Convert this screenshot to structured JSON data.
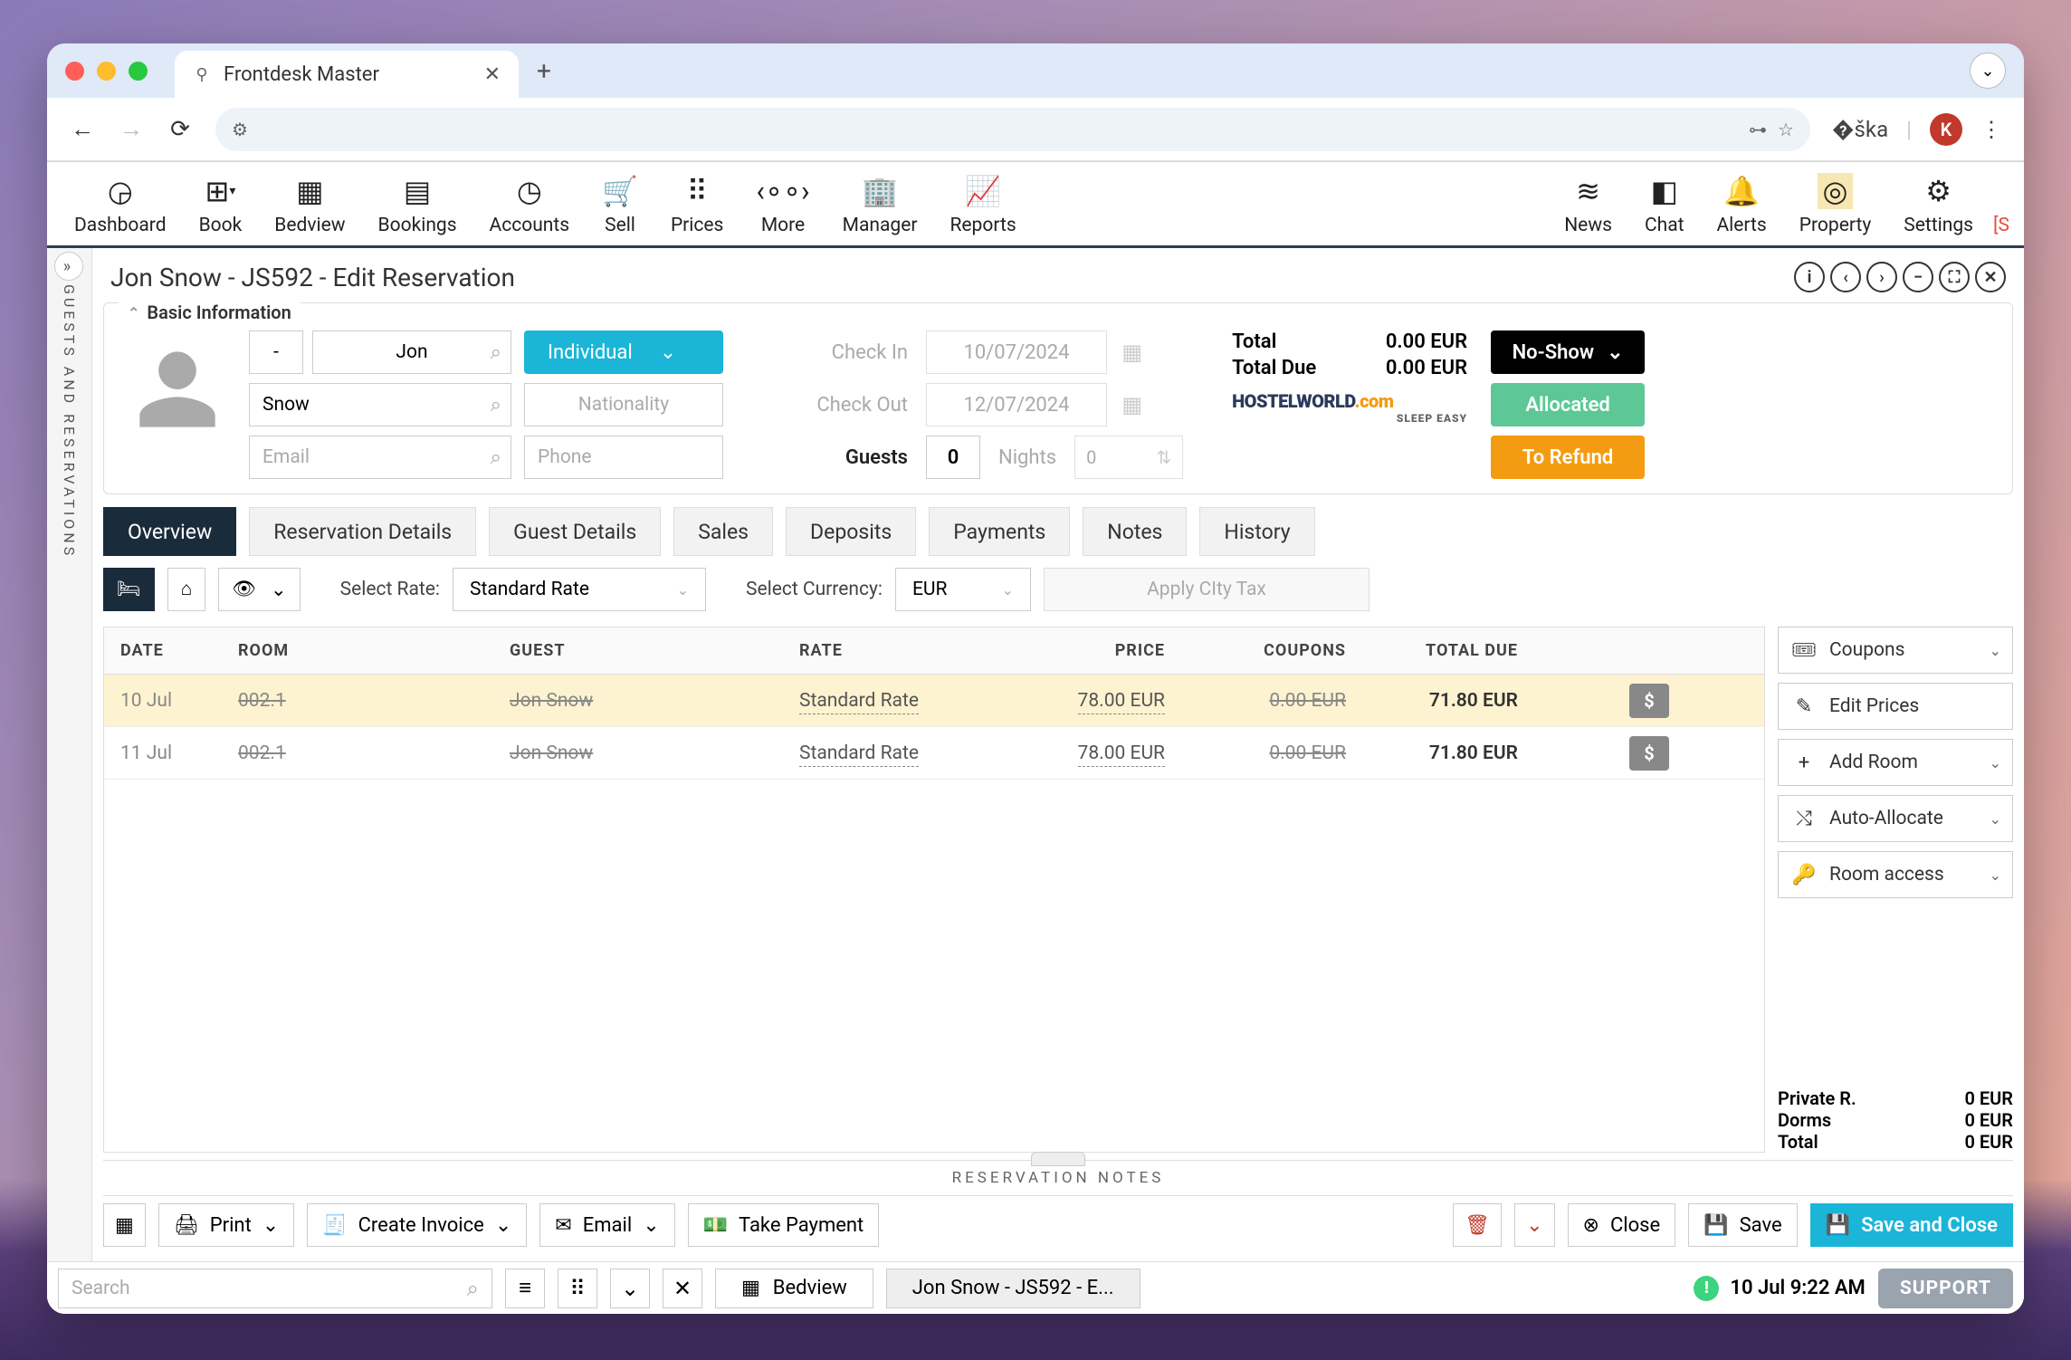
{
  "browser": {
    "tab_title": "Frontdesk Master",
    "avatar_letter": "K"
  },
  "toolbar": {
    "items": [
      "Dashboard",
      "Book",
      "Bedview",
      "Bookings",
      "Accounts",
      "Sell",
      "Prices",
      "More",
      "Manager",
      "Reports"
    ],
    "right_items": [
      "News",
      "Chat",
      "Alerts",
      "Property",
      "Settings"
    ],
    "alert_badge": "[S"
  },
  "sidebar": {
    "label": "GUESTS AND RESERVATIONS"
  },
  "panel": {
    "title": "Jon Snow - JS592 - Edit Reservation",
    "basic_legend": "Basic Information"
  },
  "guest": {
    "prefix": "-",
    "first_name": "Jon",
    "last_name": "Snow",
    "email_placeholder": "Email",
    "phone_placeholder": "Phone",
    "nationality_placeholder": "Nationality",
    "type": "Individual"
  },
  "checks": {
    "checkin_label": "Check In",
    "checkout_label": "Check Out",
    "guests_label": "Guests",
    "nights_label": "Nights",
    "checkin": "10/07/2024",
    "checkout": "12/07/2024",
    "guests": "0",
    "nights": "0"
  },
  "totals": {
    "total_label": "Total",
    "due_label": "Total Due",
    "total": "0.00 EUR",
    "due": "0.00 EUR",
    "source_logo_main": "HOSTELWORLD",
    "source_logo_suffix": ".com",
    "source_tag": "SLEEP EASY"
  },
  "status": {
    "noshow": "No-Show",
    "allocated": "Allocated",
    "refund": "To Refund"
  },
  "tabs": [
    "Overview",
    "Reservation Details",
    "Guest Details",
    "Sales",
    "Deposits",
    "Payments",
    "Notes",
    "History"
  ],
  "controls": {
    "rate_label": "Select Rate:",
    "rate_value": "Standard Rate",
    "currency_label": "Select Currency:",
    "currency_value": "EUR",
    "city_tax": "Apply CIty Tax"
  },
  "table": {
    "headers": {
      "date": "DATE",
      "room": "ROOM",
      "guest": "GUEST",
      "rate": "RATE",
      "price": "PRICE",
      "coupons": "COUPONS",
      "due": "TOTAL DUE"
    },
    "rows": [
      {
        "date": "10 Jul",
        "room": "002.1",
        "guest": "Jon Snow",
        "rate": "Standard Rate",
        "price": "78.00 EUR",
        "coupons": "0.00 EUR",
        "due": "71.80 EUR",
        "highlighted": true
      },
      {
        "date": "11 Jul",
        "room": "002.1",
        "guest": "Jon Snow",
        "rate": "Standard Rate",
        "price": "78.00 EUR",
        "coupons": "0.00 EUR",
        "due": "71.80 EUR",
        "highlighted": false
      }
    ]
  },
  "side_actions": {
    "coupons": "Coupons",
    "edit_prices": "Edit Prices",
    "add_room": "Add Room",
    "auto_allocate": "Auto-Allocate",
    "room_access": "Room access"
  },
  "summary": {
    "private_label": "Private R.",
    "private_val": "0 EUR",
    "dorms_label": "Dorms",
    "dorms_val": "0 EUR",
    "total_label": "Total",
    "total_val": "0 EUR"
  },
  "notes_header": "RESERVATION NOTES",
  "bottom": {
    "print": "Print",
    "create_invoice": "Create Invoice",
    "email": "Email",
    "take_payment": "Take Payment",
    "close": "Close",
    "save": "Save",
    "save_close": "Save and Close"
  },
  "statusbar": {
    "search_placeholder": "Search",
    "tab1": "Bedview",
    "tab2": "Jon Snow - JS592 - E...",
    "time": "10 Jul 9:22 AM",
    "support": "SUPPORT"
  }
}
